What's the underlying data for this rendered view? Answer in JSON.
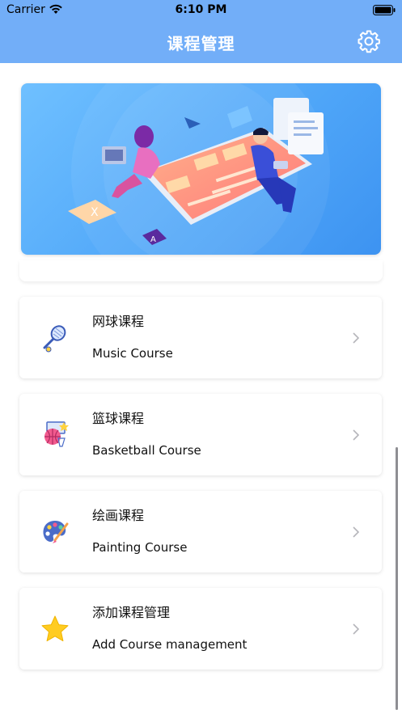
{
  "status_bar": {
    "carrier": "Carrier",
    "time": "6:10 PM"
  },
  "header": {
    "title": "课程管理",
    "settings_icon": "gear-icon"
  },
  "banner": {
    "illustration": "students-studying-online-illustration",
    "letters": [
      "X",
      "A"
    ]
  },
  "courses": [
    {
      "title": "网球课程",
      "subtitle": "Music Course",
      "icon": "tennis-racket-icon"
    },
    {
      "title": "篮球课程",
      "subtitle": "Basketball Course",
      "icon": "basketball-hoop-icon"
    },
    {
      "title": "绘画课程",
      "subtitle": "Painting Course",
      "icon": "paint-palette-icon"
    },
    {
      "title": "添加课程管理",
      "subtitle": "Add Course management",
      "icon": "star-icon"
    }
  ],
  "colors": {
    "header": "#72aef8",
    "banner": "#4ea5f8",
    "star": "#ffcc21"
  }
}
